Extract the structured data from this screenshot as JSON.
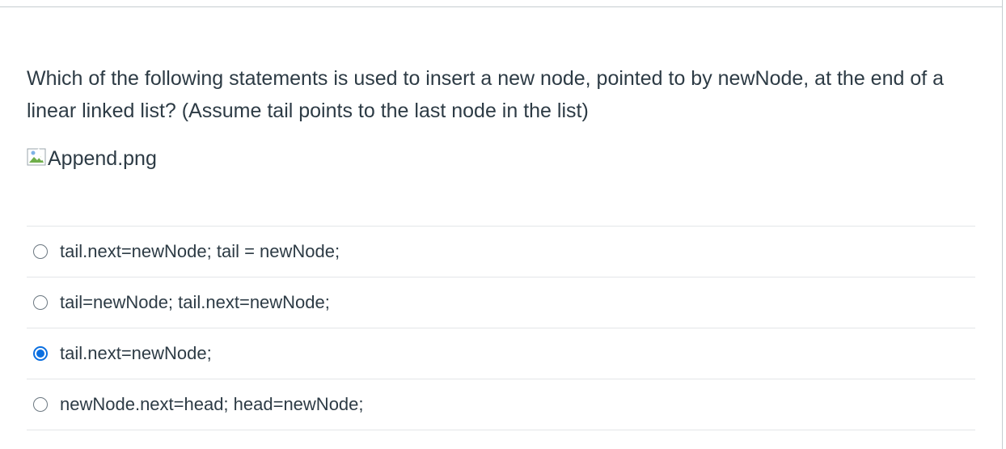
{
  "question": {
    "text": "Which of the following statements is used to insert a new node, pointed to by newNode, at the end of a linear linked list? (Assume tail points to the last node in the list)",
    "image_alt": "Append.png",
    "image_icon": "broken-image-icon"
  },
  "answers": [
    {
      "label": "tail.next=newNode; tail = newNode;",
      "selected": false
    },
    {
      "label": "tail=newNode; tail.next=newNode;",
      "selected": false
    },
    {
      "label": "tail.next=newNode;",
      "selected": true
    },
    {
      "label": "newNode.next=head; head=newNode;",
      "selected": false
    }
  ],
  "colors": {
    "text": "#2d3b45",
    "radio_selected": "#0b6fe0",
    "divider": "#e3e6e8"
  }
}
